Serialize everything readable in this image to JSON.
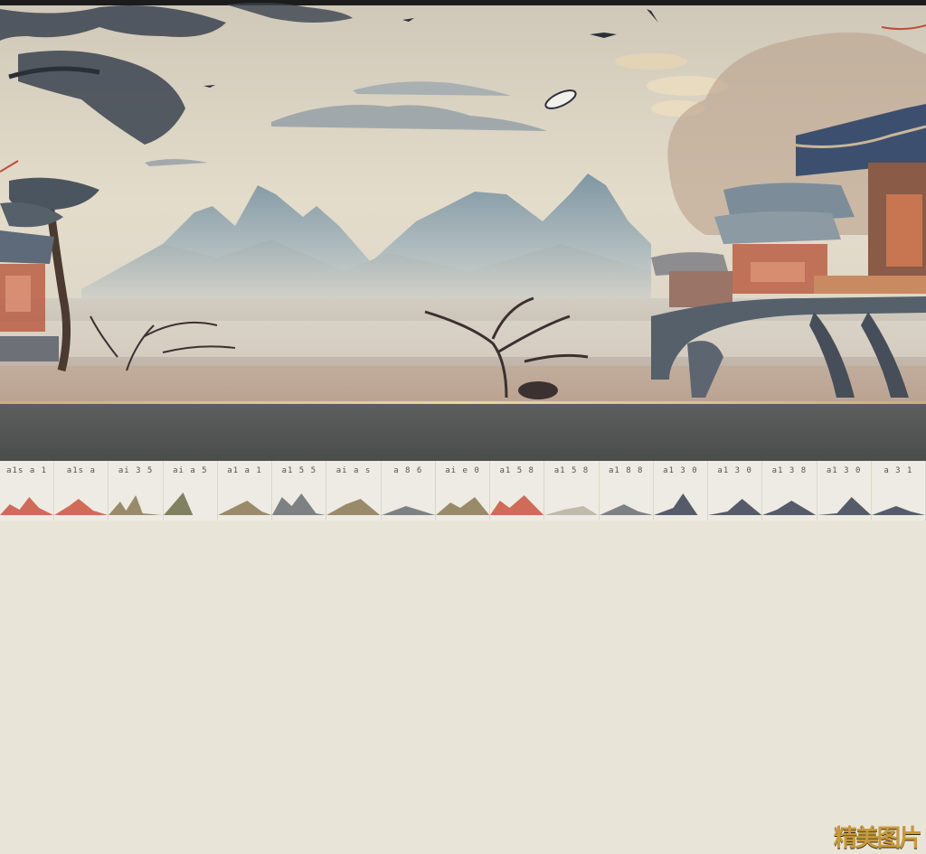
{
  "scene": {
    "colors": {
      "sky": "#ddd6c6",
      "mountain": "#8fa1aa",
      "roof": "#3d4f6e",
      "building_accent": "#b8573c",
      "mist": "#c7c0b2",
      "gold": "#c79a3c"
    }
  },
  "brand": {
    "logo_text": "精美图片"
  },
  "thumbnails": [
    {
      "label": "a1s a 1"
    },
    {
      "label": "a1s a"
    },
    {
      "label": "ai 3 5"
    },
    {
      "label": "ai a 5"
    },
    {
      "label": "a1 a 1"
    },
    {
      "label": "a1 5 5"
    },
    {
      "label": "ai a s"
    },
    {
      "label": "a 8 6"
    },
    {
      "label": "ai e 0"
    },
    {
      "label": "a1 5 8"
    },
    {
      "label": "a1 5 8"
    },
    {
      "label": "a1 8 8"
    },
    {
      "label": "a1 3 0"
    },
    {
      "label": "a1 3 0"
    },
    {
      "label": "a1 3 8"
    },
    {
      "label": "a1 3 0"
    },
    {
      "label": "a 3 1"
    }
  ]
}
